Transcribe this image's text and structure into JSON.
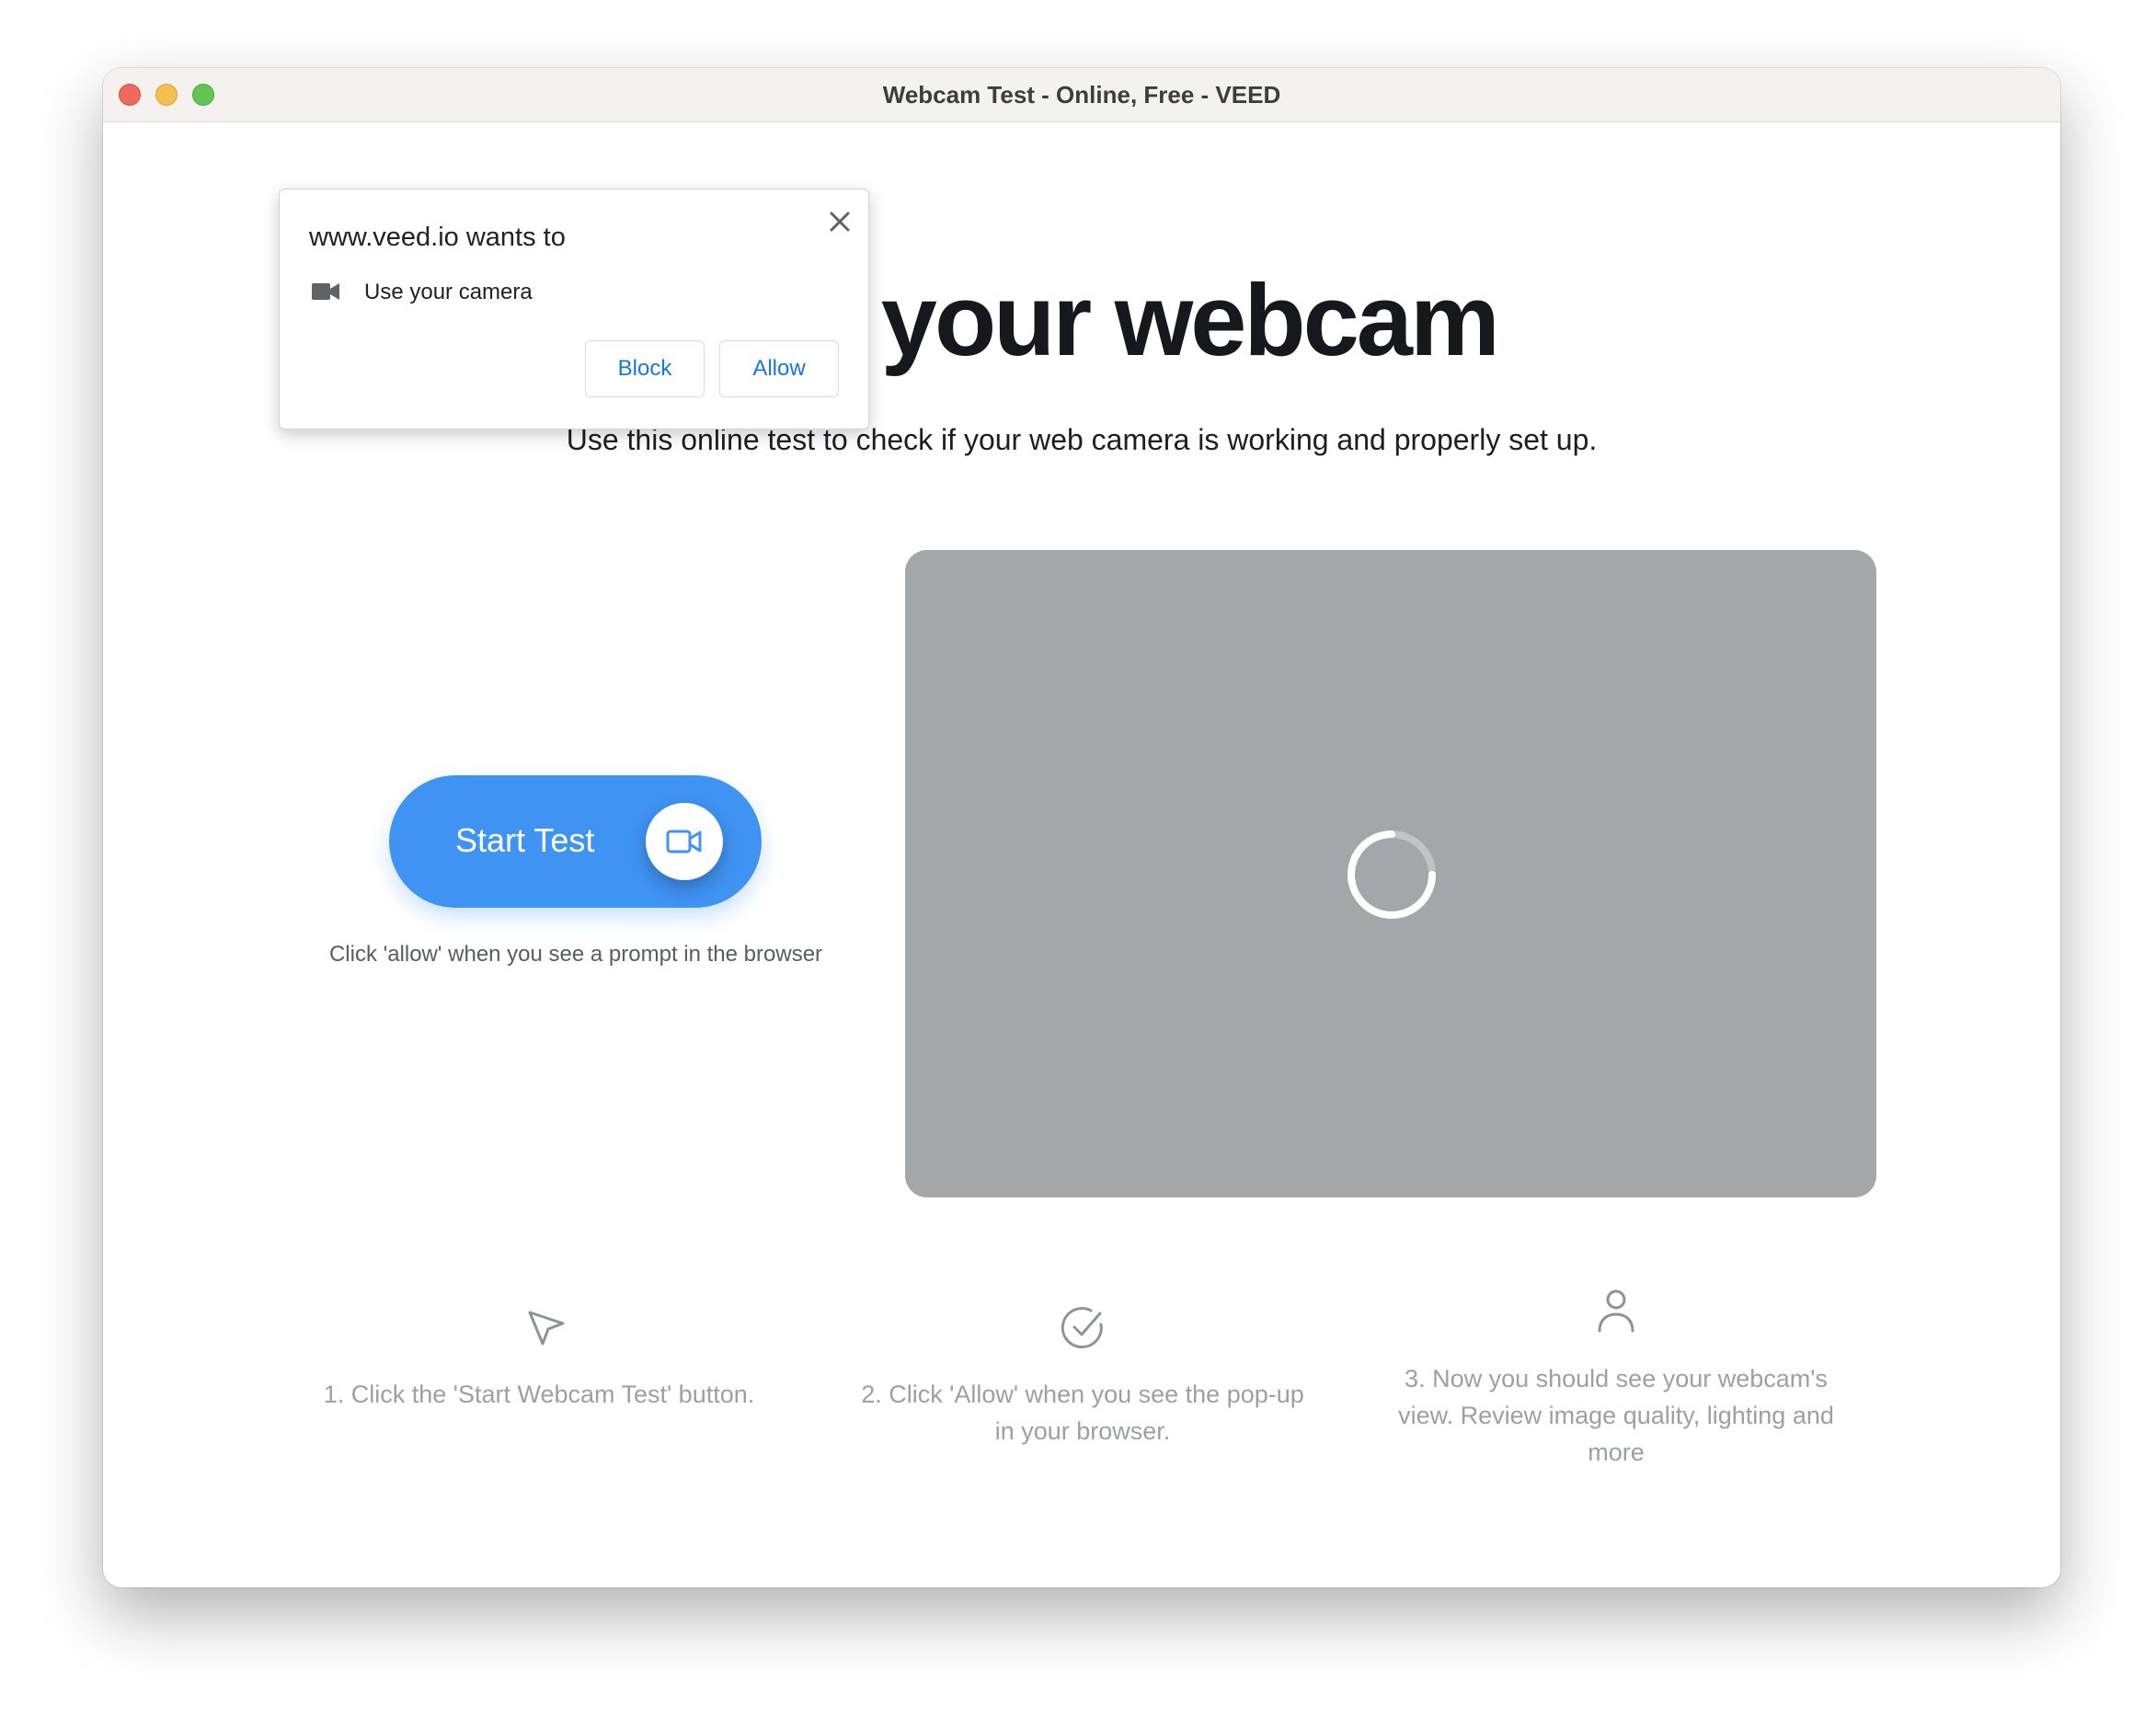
{
  "window": {
    "title": "Webcam Test - Online, Free - VEED"
  },
  "hero": {
    "title": "Test your webcam",
    "subtitle": "Use this online test to check if your web camera is working and properly set up."
  },
  "start": {
    "label": "Start Test",
    "icon": "video-camera-icon",
    "hint": "Click 'allow' when you see a prompt in the browser"
  },
  "preview": {
    "state": "loading",
    "icon": "loading-spinner-icon"
  },
  "steps": [
    {
      "icon": "cursor-arrow-icon",
      "text": "1. Click the 'Start Webcam Test' button."
    },
    {
      "icon": "check-circle-icon",
      "text": "2. Click 'Allow' when you see the pop-up in your browser."
    },
    {
      "icon": "user-icon",
      "text": "3. Now you should see your webcam's view. Review image quality, lighting and more"
    }
  ],
  "permission_popup": {
    "title": "www.veed.io wants to",
    "item": "Use your camera",
    "item_icon": "camera-icon",
    "block_label": "Block",
    "allow_label": "Allow",
    "close_icon": "close-icon"
  },
  "colors": {
    "accent": "#3f93f3",
    "preview_bg": "#a5a6aa",
    "link_blue": "#1a73e8"
  }
}
